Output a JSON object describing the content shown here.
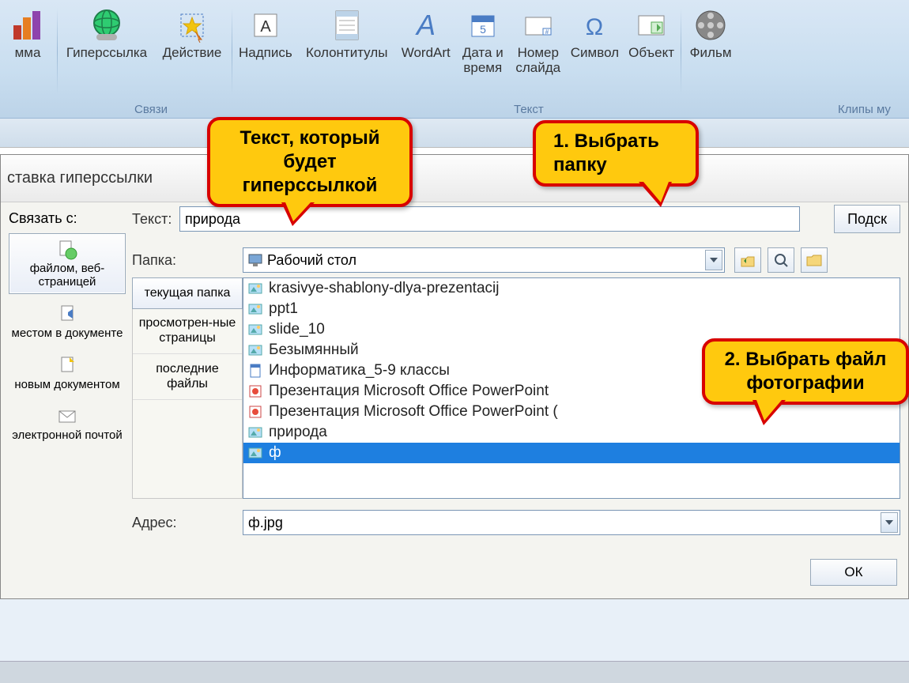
{
  "ribbon": {
    "buttons": [
      {
        "label": "мма"
      },
      {
        "label": "Гиперссылка"
      },
      {
        "label": "Действие"
      },
      {
        "label": "Надпись"
      },
      {
        "label": "Колонтитулы"
      },
      {
        "label": "WordArt"
      },
      {
        "label": "Дата и\nвремя"
      },
      {
        "label": "Номер\nслайда"
      },
      {
        "label": "Символ"
      },
      {
        "label": "Объект"
      },
      {
        "label": "Фильм"
      }
    ],
    "groups": {
      "links": "Связи",
      "text": "Текст",
      "media": "Клипы му"
    }
  },
  "dialog": {
    "title": "ставка гиперссылки",
    "linkTo": "Связать с:",
    "textLabel": "Текст:",
    "textValue": "природа",
    "hintBtn": "Подск",
    "sidebar": [
      "файлом, веб-страницей",
      "местом в документе",
      "новым документом",
      "электронной почтой"
    ],
    "folderLabel": "Папка:",
    "folderValue": "Рабочий стол",
    "browseTabs": [
      "текущая папка",
      "просмотрен-ные страницы",
      "последние файлы"
    ],
    "files": [
      {
        "name": "krasivye-shablony-dlya-prezentacij",
        "type": "img"
      },
      {
        "name": "ppt1",
        "type": "img"
      },
      {
        "name": "slide_10",
        "type": "img"
      },
      {
        "name": "Безымянный",
        "type": "img"
      },
      {
        "name": "Информатика_5-9 классы",
        "type": "doc"
      },
      {
        "name": "Презентация Microsoft Office PowerPoint",
        "type": "ppt"
      },
      {
        "name": "Презентация Microsoft Office PowerPoint (",
        "type": "ppt"
      },
      {
        "name": "природа",
        "type": "img"
      },
      {
        "name": "ф",
        "type": "img",
        "selected": true
      }
    ],
    "addressLabel": "Адрес:",
    "addressValue": "ф.jpg",
    "okBtn": "ОК"
  },
  "callouts": {
    "c1": "Текст, который будет гиперссылкой",
    "c2": "1. Выбрать папку",
    "c3": "2. Выбрать файл фотографии"
  }
}
